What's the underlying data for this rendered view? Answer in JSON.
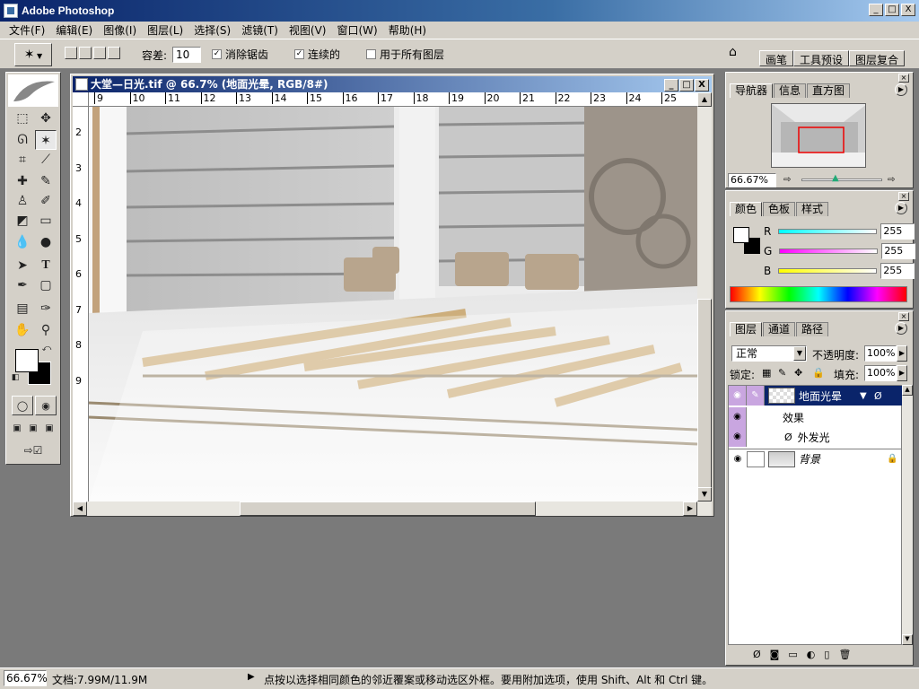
{
  "window": {
    "title": "Adobe Photoshop",
    "min": "_",
    "max": "□",
    "close": "X"
  },
  "menu": [
    "文件(F)",
    "编辑(E)",
    "图像(I)",
    "图层(L)",
    "选择(S)",
    "滤镜(T)",
    "视图(V)",
    "窗口(W)",
    "帮助(H)"
  ],
  "options": {
    "tolerance_label": "容差:",
    "tolerance_value": "10",
    "antialias_label": "消除锯齿",
    "contiguous_label": "连续的",
    "all_layers_label": "用于所有图层",
    "palette_tabs": [
      "画笔",
      "工具预设",
      "图层复合"
    ]
  },
  "document": {
    "title": "大堂—日光.tif @ 66.7% (地面光晕, RGB/8#)",
    "ruler_h": [
      "9",
      "10",
      "11",
      "12",
      "13",
      "14",
      "15",
      "16",
      "17",
      "18",
      "19",
      "20",
      "21",
      "22",
      "23",
      "24",
      "25"
    ],
    "ruler_v": [
      "2",
      "3",
      "4",
      "5",
      "6",
      "7",
      "8",
      "9"
    ]
  },
  "navigator": {
    "tabs": [
      "导航器",
      "信息",
      "直方图"
    ],
    "zoom": "66.67%"
  },
  "color": {
    "tabs": [
      "颜色",
      "色板",
      "样式"
    ],
    "channels": [
      {
        "label": "R",
        "value": "255",
        "gradient": "linear-gradient(to right,#0ff,#fff)"
      },
      {
        "label": "G",
        "value": "255",
        "gradient": "linear-gradient(to right,#f0f,#fff)"
      },
      {
        "label": "B",
        "value": "255",
        "gradient": "linear-gradient(to right,#ff0,#fff)"
      }
    ]
  },
  "layers": {
    "tabs": [
      "图层",
      "通道",
      "路径"
    ],
    "blend_mode": "正常",
    "opacity_label": "不透明度:",
    "opacity_value": "100%",
    "lock_label": "锁定:",
    "fill_label": "填充:",
    "fill_value": "100%",
    "items": [
      {
        "name": "地面光晕",
        "selected": true
      },
      {
        "name": "效果",
        "sub": true
      },
      {
        "name": "外发光",
        "sub": true
      },
      {
        "name": "背景",
        "italic": true
      }
    ]
  },
  "status": {
    "zoom": "66.67%",
    "doc_size": "文档:7.99M/11.9M",
    "hint": "点按以选择相同颜色的邻近覆案或移动选区外框。要用附加选项，使用 Shift、Alt 和 Ctrl 键。"
  },
  "colors": {
    "title_dark": "#0a246a",
    "title_light": "#a6caf0",
    "chrome": "#d4d0c8",
    "layer_selected": "#0a246a"
  }
}
